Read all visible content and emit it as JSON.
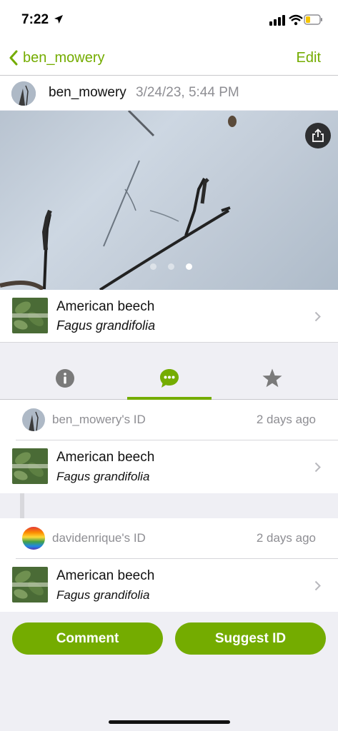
{
  "status_bar": {
    "time": "7:22"
  },
  "nav": {
    "back_label": "ben_mowery",
    "edit_label": "Edit"
  },
  "observation": {
    "user": "ben_mowery",
    "date": "3/24/23, 5:44 PM",
    "photo_count": 3,
    "active_photo_index": 2
  },
  "taxon": {
    "common_name": "American beech",
    "scientific_name": "Fagus grandifolia"
  },
  "tabs": [
    {
      "name": "info",
      "icon": "info-icon"
    },
    {
      "name": "activity",
      "icon": "chat-bubble-icon",
      "selected": true
    },
    {
      "name": "favorites",
      "icon": "star-icon"
    }
  ],
  "identifications": [
    {
      "header": "ben_mowery's ID",
      "time_ago": "2 days ago",
      "common_name": "American beech",
      "scientific_name": "Fagus grandifolia"
    },
    {
      "header": "davidenrique's ID",
      "time_ago": "2 days ago",
      "common_name": "American beech",
      "scientific_name": "Fagus grandifolia"
    }
  ],
  "actions": {
    "comment_label": "Comment",
    "suggest_label": "Suggest ID"
  },
  "colors": {
    "accent": "#74ac00",
    "secondary_text": "#8e8e93",
    "background": "#efeff4"
  }
}
